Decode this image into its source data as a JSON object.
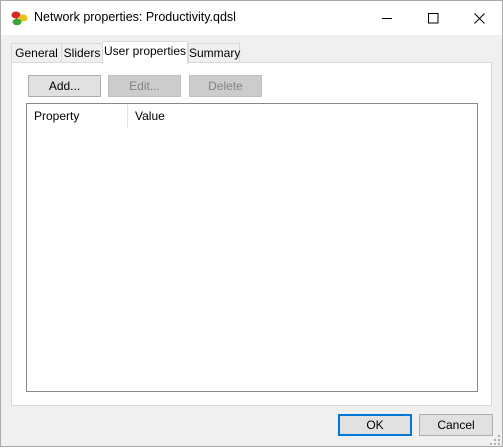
{
  "window": {
    "title": "Network properties: Productivity.qdsl",
    "icon": "network-graph-icon",
    "controls": [
      "minimize-icon",
      "maximize-icon",
      "close-icon"
    ]
  },
  "tabs": [
    {
      "label": "General",
      "active": false
    },
    {
      "label": "Sliders",
      "active": false
    },
    {
      "label": "User properties",
      "active": true
    },
    {
      "label": "Summary",
      "active": false
    }
  ],
  "toolbar": {
    "add_label": "Add...",
    "edit_label": "Edit...",
    "delete_label": "Delete"
  },
  "listview": {
    "columns": [
      "Property",
      "Value"
    ],
    "rows": []
  },
  "footer": {
    "ok_label": "OK",
    "cancel_label": "Cancel"
  },
  "colors": {
    "accent": "#0078d7",
    "window_bg": "#f0f0f0",
    "disabled_text": "#838383"
  }
}
